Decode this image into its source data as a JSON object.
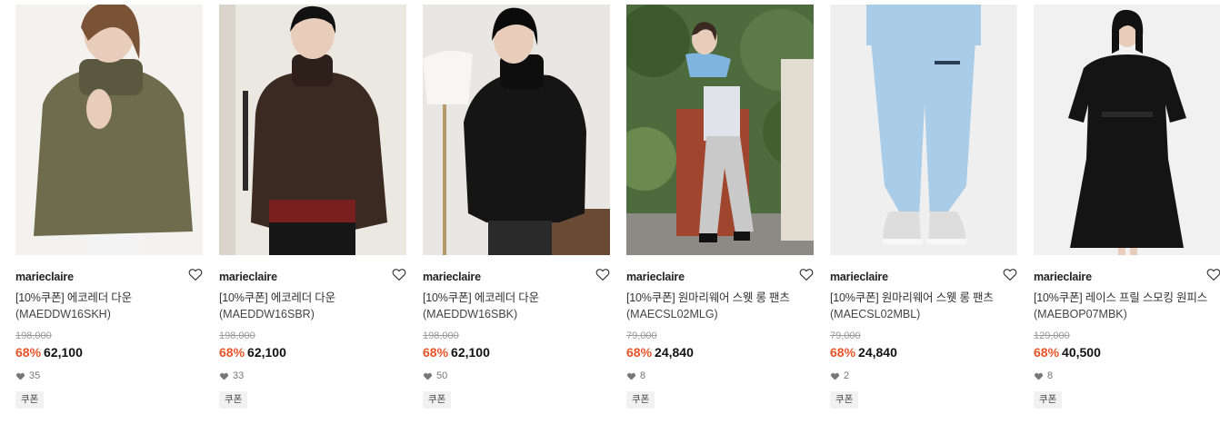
{
  "products": [
    {
      "brand": "marieclaire",
      "name": "[10%쿠폰] 에코레더 다운",
      "code": "(MAEDDW16SKH)",
      "original_price": "198,000",
      "discount": "68%",
      "price": "62,100",
      "likes": "35",
      "badge": "쿠폰",
      "colors": {
        "bg": "#f4f2ef",
        "garment": "#6f6b4d",
        "accent": "#5b5840"
      }
    },
    {
      "brand": "marieclaire",
      "name": "[10%쿠폰] 에코레더 다운",
      "code": "(MAEDDW16SBR)",
      "original_price": "198,000",
      "discount": "68%",
      "price": "62,100",
      "likes": "33",
      "badge": "쿠폰",
      "colors": {
        "bg": "#ebe7e1",
        "garment": "#3b2a22",
        "accent": "#7a1f1f"
      }
    },
    {
      "brand": "marieclaire",
      "name": "[10%쿠폰] 에코레더 다운",
      "code": "(MAEDDW16SBK)",
      "original_price": "198,000",
      "discount": "68%",
      "price": "62,100",
      "likes": "50",
      "badge": "쿠폰",
      "colors": {
        "bg": "#e9e7e3",
        "garment": "#151515",
        "accent": "#6a4a34"
      }
    },
    {
      "brand": "marieclaire",
      "name": "[10%쿠폰] 원마리웨어 스웻 롱 팬츠",
      "code": "(MAECSL02MLG)",
      "original_price": "79,000",
      "discount": "68%",
      "price": "24,840",
      "likes": "8",
      "badge": "쿠폰",
      "colors": {
        "bg": "#4d6b3c",
        "garment": "#c9c9c9",
        "accent": "#a0452e"
      }
    },
    {
      "brand": "marieclaire",
      "name": "[10%쿠폰] 원마리웨어 스웻 롱 팬츠",
      "code": "(MAECSL02MBL)",
      "original_price": "79,000",
      "discount": "68%",
      "price": "24,840",
      "likes": "2",
      "badge": "쿠폰",
      "colors": {
        "bg": "#efefef",
        "garment": "#a9cde9",
        "accent": "#dddddd"
      }
    },
    {
      "brand": "marieclaire",
      "name": "[10%쿠폰] 레이스 프릴 스모킹 원피스",
      "code": "(MAEBOP07MBK)",
      "original_price": "129,000",
      "discount": "68%",
      "price": "40,500",
      "likes": "8",
      "badge": "쿠폰",
      "colors": {
        "bg": "#f1f1f1",
        "garment": "#141414",
        "accent": "#2a2a2a"
      }
    }
  ]
}
